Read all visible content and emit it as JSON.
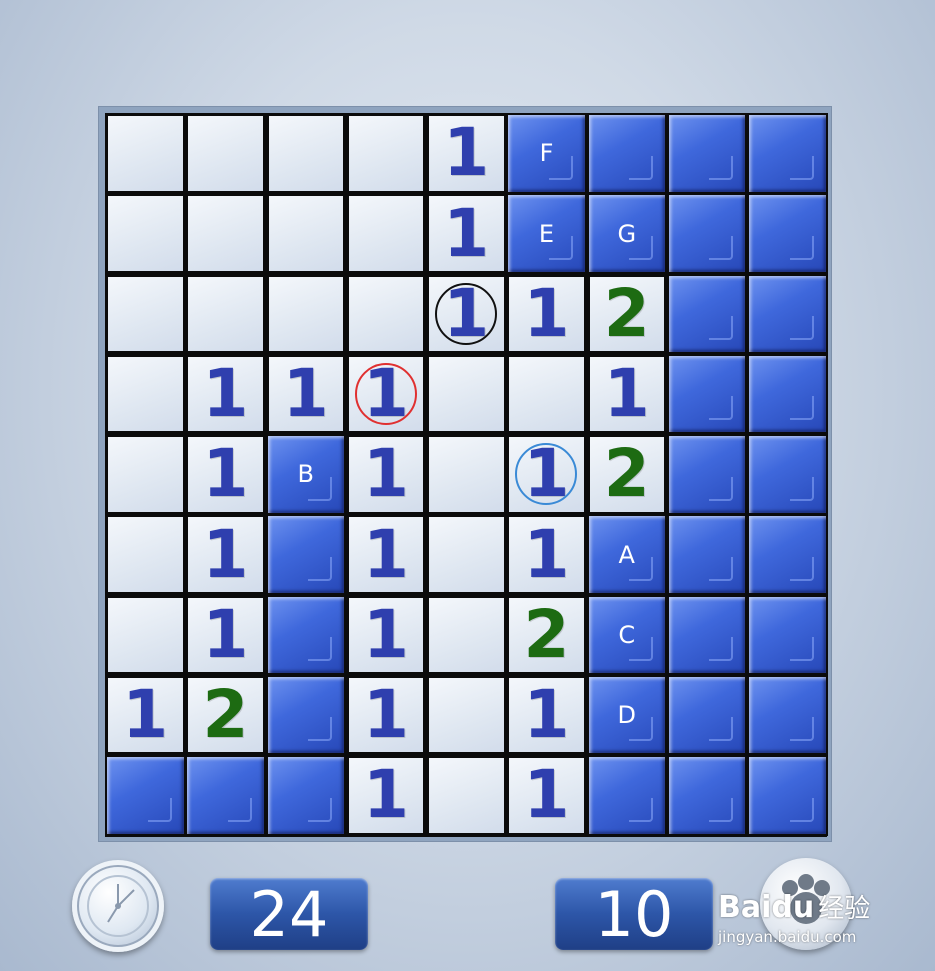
{
  "board": {
    "rows": [
      [
        "",
        "",
        "",
        "",
        "1",
        "#",
        "#",
        "#",
        "#"
      ],
      [
        "",
        "",
        "",
        "",
        "1",
        "#",
        "#",
        "#",
        "#"
      ],
      [
        "",
        "",
        "",
        "",
        "1",
        "1",
        "2",
        "#",
        "#"
      ],
      [
        "",
        "1",
        "1",
        "1",
        "",
        "",
        "1",
        "#",
        "#"
      ],
      [
        "",
        "1",
        "#",
        "1",
        "",
        "1",
        "2",
        "#",
        "#"
      ],
      [
        "",
        "1",
        "#",
        "1",
        "",
        "1",
        "#",
        "#",
        "#"
      ],
      [
        "",
        "1",
        "#",
        "1",
        "",
        "2",
        "#",
        "#",
        "#"
      ],
      [
        "1",
        "2",
        "#",
        "1",
        "",
        "1",
        "#",
        "#",
        "#"
      ],
      [
        "#",
        "#",
        "#",
        "1",
        "",
        "1",
        "#",
        "#",
        "#"
      ]
    ],
    "labels": [
      {
        "row": 0,
        "col": 5,
        "text": "F"
      },
      {
        "row": 1,
        "col": 5,
        "text": "E"
      },
      {
        "row": 1,
        "col": 6,
        "text": "G"
      },
      {
        "row": 4,
        "col": 2,
        "text": "B"
      },
      {
        "row": 5,
        "col": 6,
        "text": "A"
      },
      {
        "row": 6,
        "col": 6,
        "text": "C"
      },
      {
        "row": 7,
        "col": 6,
        "text": "D"
      }
    ],
    "markers": [
      {
        "row": 2,
        "col": 4,
        "color": "#111111"
      },
      {
        "row": 3,
        "col": 3,
        "color": "#e03030"
      },
      {
        "row": 4,
        "col": 5,
        "color": "#3a8ad6"
      }
    ]
  },
  "status": {
    "time": "24",
    "mines_left": "10"
  },
  "watermark": {
    "brand": "Baidu",
    "cn": "经验",
    "url": "jingyan.baidu.com"
  }
}
